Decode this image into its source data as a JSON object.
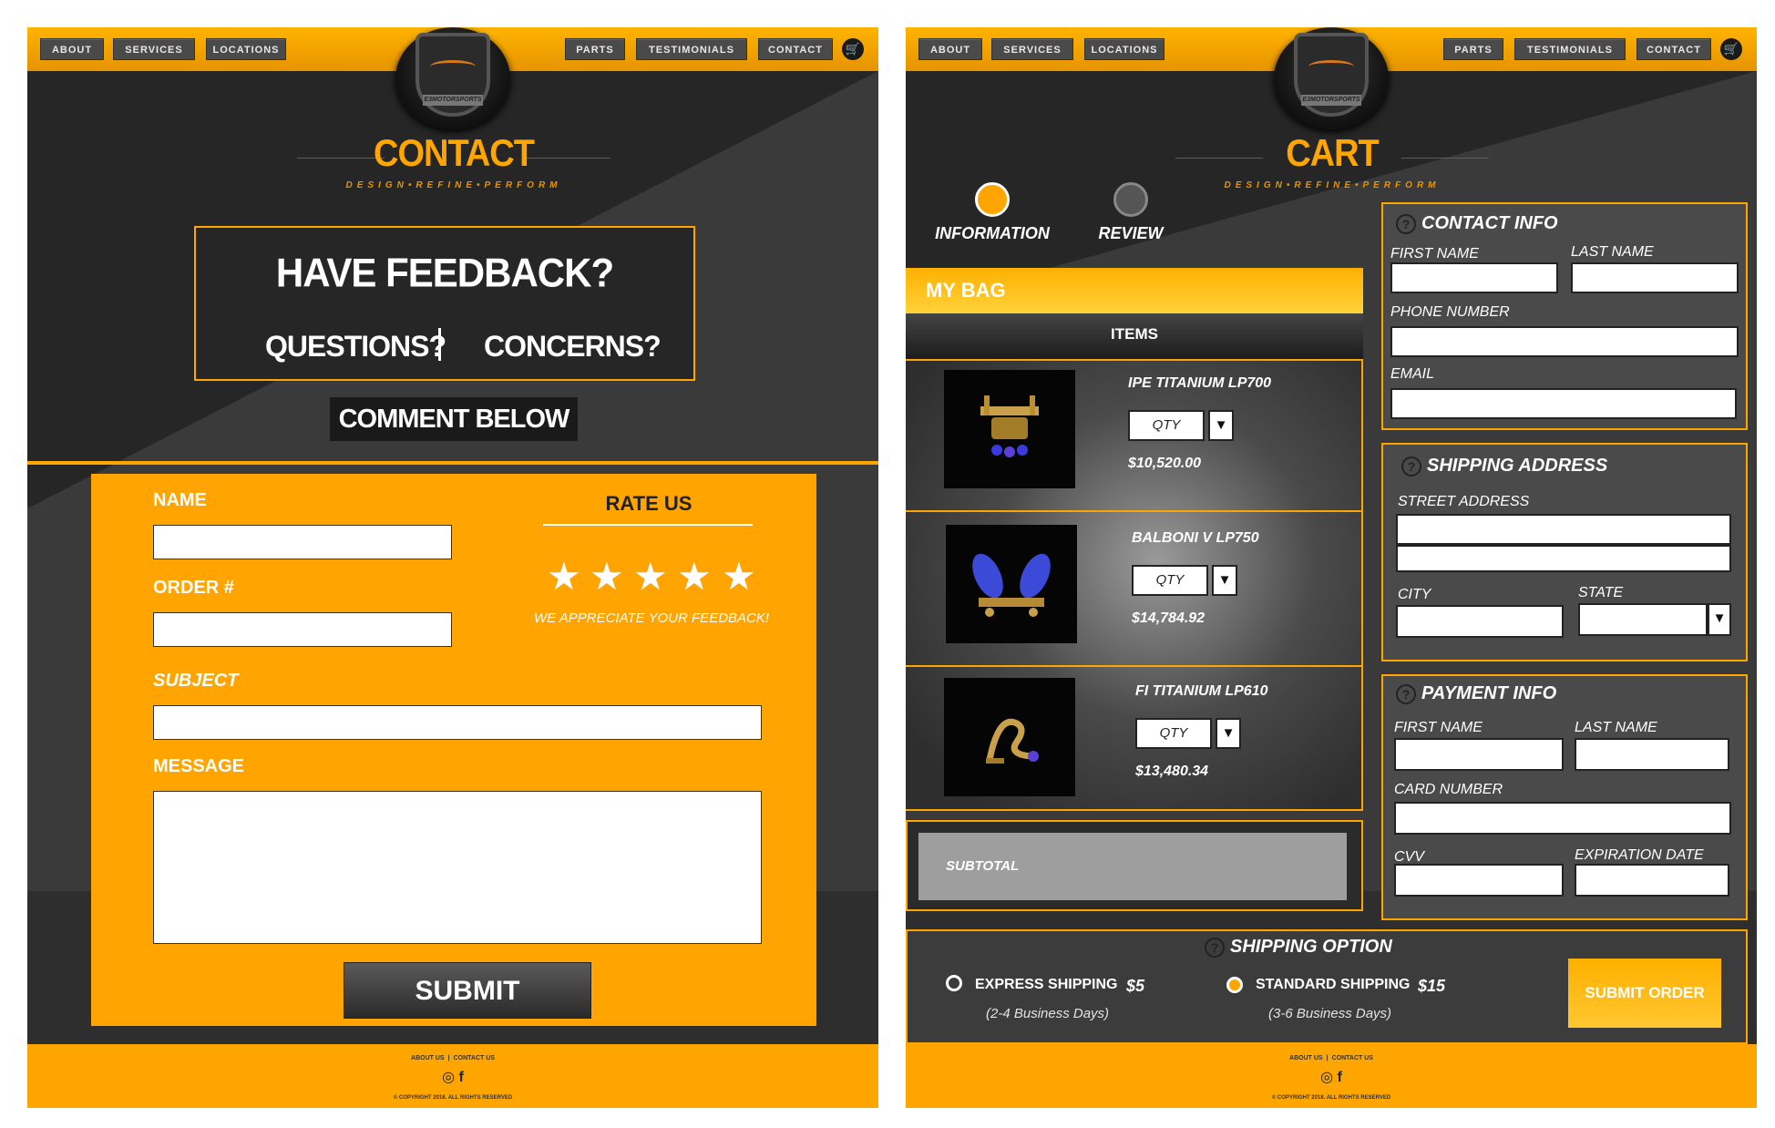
{
  "nav": {
    "left": [
      "ABOUT",
      "SERVICES",
      "LOCATIONS"
    ],
    "right": [
      "PARTS",
      "TESTIMONIALS",
      "CONTACT"
    ],
    "cart_icon": "cart-icon"
  },
  "logo": {
    "text": "E3MOTORSPORTS"
  },
  "tagline": "DESIGN•REFINE•PERFORM",
  "contact": {
    "title": "CONTACT",
    "feedback_title": "HAVE FEEDBACK?",
    "questions": "QUESTIONS?",
    "concerns": "CONCERNS?",
    "comment_below": "COMMENT BELOW",
    "form": {
      "name_label": "NAME",
      "order_label": "ORDER #",
      "subject_label": "SUBJECT",
      "message_label": "MESSAGE",
      "rate_title": "RATE US",
      "rating_max": 5,
      "appreciate": "WE APPRECIATE YOUR FEEDBACK!",
      "submit": "SUBMIT"
    }
  },
  "cart": {
    "title": "CART",
    "steps": [
      {
        "label": "INFORMATION",
        "active": true
      },
      {
        "label": "REVIEW",
        "active": false
      }
    ],
    "bag_title": "MY BAG",
    "items_header": "ITEMS",
    "items": [
      {
        "name": "IPE TITANIUM LP700",
        "qty": "QTY",
        "price": "$10,520.00"
      },
      {
        "name": "BALBONI V LP750",
        "qty": "QTY",
        "price": "$14,784.92"
      },
      {
        "name": "FI TITANIUM LP610",
        "qty": "QTY",
        "price": "$13,480.34"
      }
    ],
    "subtotal": "SUBTOTAL",
    "contact_info": {
      "title": "CONTACT INFO",
      "first_name": "FIRST NAME",
      "last_name": "LAST NAME",
      "phone": "PHONE NUMBER",
      "email": "EMAIL"
    },
    "shipping_address": {
      "title": "SHIPPING ADDRESS",
      "street": "STREET ADDRESS",
      "city": "CITY",
      "state": "STATE"
    },
    "payment_info": {
      "title": "PAYMENT INFO",
      "first_name": "FIRST NAME",
      "last_name": "LAST NAME",
      "card_number": "CARD NUMBER",
      "cvv": "CVV",
      "expiration": "EXPIRATION DATE"
    },
    "shipping_option": {
      "title": "SHIPPING OPTION",
      "express_label": "EXPRESS SHIPPING",
      "express_price": "$5",
      "express_days": "(2-4 Business Days)",
      "standard_label": "STANDARD SHIPPING",
      "standard_price": "$15",
      "standard_days": "(3-6 Business Days)",
      "selected": "standard"
    },
    "submit_order": "SUBMIT ORDER"
  },
  "footer": {
    "links": [
      "ABOUT US",
      "CONTACT US"
    ],
    "icons": [
      "instagram-icon",
      "facebook-icon"
    ],
    "copyright": "© COPYRIGHT 2018. ALL RIGHTS RESERVED"
  },
  "colors": {
    "accent": "#ffa500",
    "dark": "#2e2e2e",
    "panel": "#4a4a4a"
  }
}
